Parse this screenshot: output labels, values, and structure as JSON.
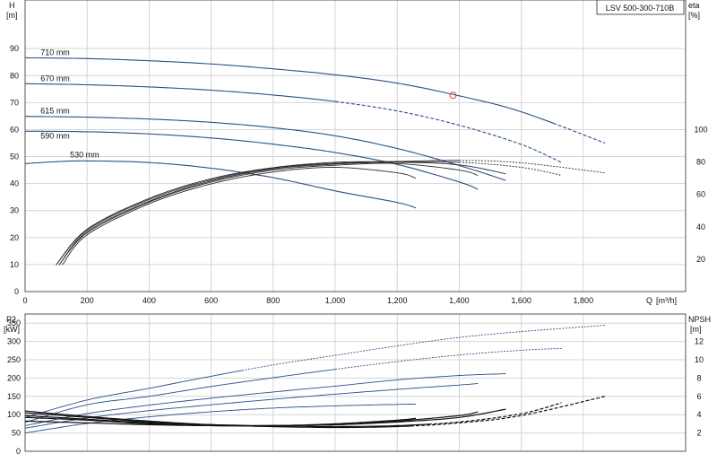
{
  "chart_data": [
    {
      "type": "line",
      "title": "LSV 500-300-710B",
      "ylabel": "H",
      "yunit": "[m]",
      "y2label": "eta",
      "y2unit": "[%]",
      "xlabel": "Q",
      "xunit": "[m³/h]",
      "xlim": [
        0,
        2130
      ],
      "ylim": [
        0,
        108
      ],
      "y2lim": [
        0,
        180
      ],
      "x_ticks": [
        0,
        200,
        400,
        600,
        800,
        1000,
        1200,
        1400,
        1600,
        1800
      ],
      "x_tick_labels": [
        "0",
        "200",
        "400",
        "600",
        "800",
        "1,000",
        "1,200",
        "1,400",
        "1,600",
        "1,800"
      ],
      "y_ticks": [
        0,
        10,
        20,
        30,
        40,
        50,
        60,
        70,
        80,
        90
      ],
      "y2_ticks": [
        20,
        40,
        60,
        80,
        100
      ],
      "grid": true,
      "series": [
        {
          "name": "710 mm",
          "x": [
            0,
            200,
            400,
            600,
            800,
            1000,
            1200,
            1400,
            1600,
            1870
          ],
          "y": [
            86.6,
            86.3,
            85.5,
            84.3,
            82.5,
            80.3,
            77.2,
            72.5,
            66.6,
            55.0
          ],
          "solid_until": 1720,
          "label_at": [
            50,
            87.5
          ]
        },
        {
          "name": "670 mm",
          "x": [
            0,
            200,
            400,
            600,
            800,
            1000,
            1200,
            1400,
            1600,
            1730
          ],
          "y": [
            77.0,
            76.6,
            75.8,
            74.6,
            72.8,
            70.4,
            66.9,
            61.6,
            54.5,
            47.8
          ],
          "solid_until": 1000,
          "label_at": [
            50,
            78.0
          ]
        },
        {
          "name": "615 mm",
          "x": [
            0,
            200,
            400,
            600,
            800,
            1000,
            1200,
            1400,
            1550
          ],
          "y": [
            64.9,
            64.6,
            63.9,
            62.7,
            60.7,
            57.7,
            53.0,
            46.7,
            41.2
          ],
          "solid_until": 1550,
          "label_at": [
            50,
            66.0
          ]
        },
        {
          "name": "590 mm",
          "x": [
            0,
            200,
            400,
            600,
            800,
            1000,
            1200,
            1400,
            1460
          ],
          "y": [
            59.4,
            59.2,
            58.4,
            56.9,
            54.6,
            51.5,
            47.1,
            40.6,
            37.9
          ],
          "solid_until": 1460,
          "label_at": [
            50,
            56.6
          ]
        },
        {
          "name": "530 mm",
          "x": [
            0,
            100,
            200,
            400,
            600,
            800,
            1000,
            1200,
            1260
          ],
          "y": [
            47.4,
            48.1,
            48.4,
            47.8,
            45.7,
            42.2,
            37.3,
            33.0,
            31.0
          ],
          "solid_until": 1260,
          "label_at": [
            145,
            49.7
          ]
        }
      ],
      "efficiency_series": [
        {
          "curve": "710 mm",
          "x": [
            100,
            200,
            400,
            600,
            800,
            1000,
            1200,
            1400,
            1600,
            1870
          ],
          "y": [
            16.5,
            38.5,
            57.5,
            69.7,
            76.5,
            79.8,
            80.3,
            81.0,
            79.5,
            73.3
          ],
          "solid_until": 1400
        },
        {
          "curve": "670 mm",
          "x": [
            100,
            200,
            400,
            600,
            800,
            1000,
            1200,
            1400,
            1600,
            1730
          ],
          "y": [
            16.5,
            38.0,
            56.8,
            69.0,
            76.2,
            79.2,
            80.0,
            79.8,
            76.7,
            71.7
          ],
          "solid_until": 1400
        },
        {
          "curve": "615 mm",
          "x": [
            110,
            200,
            400,
            600,
            800,
            1000,
            1200,
            1400,
            1550
          ],
          "y": [
            16.5,
            37.0,
            55.8,
            68.3,
            75.7,
            78.7,
            79.8,
            78.2,
            72.7
          ],
          "solid_until": 1550
        },
        {
          "curve": "590 mm",
          "x": [
            110,
            200,
            400,
            600,
            800,
            1000,
            1200,
            1400,
            1460
          ],
          "y": [
            16.5,
            36.2,
            55.2,
            67.6,
            75.0,
            78.0,
            79.0,
            75.0,
            71.7
          ],
          "solid_until": 1460
        },
        {
          "curve": "530 mm",
          "x": [
            120,
            200,
            400,
            600,
            800,
            1000,
            1200,
            1260
          ],
          "y": [
            16.5,
            35.0,
            54.2,
            66.5,
            73.8,
            76.7,
            73.3,
            70.0
          ],
          "solid_until": 1260
        }
      ],
      "marker": {
        "x": 1380,
        "y": 72.7
      }
    },
    {
      "type": "line",
      "ylabel": "P2",
      "yunit": "[kW]",
      "y2label": "NPSH",
      "y2unit": "[m]",
      "xlim": [
        0,
        2130
      ],
      "ylim": [
        0,
        375
      ],
      "y2lim": [
        0,
        15
      ],
      "y_ticks": [
        0,
        50,
        100,
        150,
        200,
        250,
        300,
        350
      ],
      "y2_ticks": [
        2,
        4,
        6,
        8,
        10,
        12
      ],
      "grid": true,
      "power_series": [
        {
          "curve": "710 mm",
          "x": [
            0,
            200,
            400,
            600,
            800,
            1000,
            1200,
            1400,
            1600,
            1870
          ],
          "y": [
            92,
            140,
            172,
            205,
            236,
            262,
            288,
            311,
            327,
            344
          ],
          "solid_until": 700
        },
        {
          "curve": "670 mm",
          "x": [
            0,
            200,
            400,
            600,
            800,
            1000,
            1200,
            1400,
            1600,
            1730
          ],
          "y": [
            79,
            127,
            150,
            177,
            201,
            224,
            245,
            263,
            276,
            281
          ],
          "solid_until": 1000
        },
        {
          "curve": "615 mm",
          "x": [
            0,
            200,
            400,
            600,
            800,
            1000,
            1200,
            1400,
            1550
          ],
          "y": [
            70,
            103,
            126,
            145,
            162,
            178,
            195,
            207,
            212
          ],
          "solid_until": 1550
        },
        {
          "curve": "590 mm",
          "x": [
            0,
            200,
            400,
            600,
            800,
            1000,
            1200,
            1400,
            1460
          ],
          "y": [
            63,
            91,
            111,
            127,
            142,
            156,
            169,
            181,
            185
          ],
          "solid_until": 1460
        },
        {
          "curve": "530 mm",
          "x": [
            0,
            200,
            400,
            600,
            800,
            1000,
            1200,
            1260
          ],
          "y": [
            50,
            76,
            94,
            108,
            118,
            124,
            128,
            129
          ],
          "solid_until": 1260
        }
      ],
      "npsh_series": [
        {
          "curve": "710 mm",
          "x": [
            0,
            200,
            400,
            600,
            800,
            1000,
            1200,
            1400,
            1600,
            1870
          ],
          "y": [
            4.4,
            3.8,
            3.3,
            2.9,
            2.7,
            2.6,
            2.7,
            3.1,
            3.9,
            6.0
          ],
          "solid_until": 1250
        },
        {
          "curve": "670 mm",
          "x": [
            0,
            200,
            400,
            600,
            800,
            1000,
            1200,
            1400,
            1600,
            1730
          ],
          "y": [
            4.2,
            3.7,
            3.2,
            2.9,
            2.7,
            2.7,
            2.8,
            3.2,
            4.1,
            5.3
          ],
          "solid_until": 1300
        },
        {
          "curve": "615 mm",
          "x": [
            0,
            200,
            400,
            600,
            800,
            1000,
            1200,
            1400,
            1550
          ],
          "y": [
            3.9,
            3.5,
            3.1,
            2.9,
            2.8,
            2.9,
            3.2,
            3.7,
            4.6
          ],
          "solid_until": 1550
        },
        {
          "curve": "590 mm",
          "x": [
            0,
            200,
            400,
            600,
            800,
            1000,
            1200,
            1400,
            1460
          ],
          "y": [
            3.7,
            3.4,
            3.0,
            2.8,
            2.8,
            2.9,
            3.3,
            3.9,
            4.3
          ],
          "solid_until": 1460
        },
        {
          "curve": "530 mm",
          "x": [
            0,
            200,
            400,
            600,
            800,
            1000,
            1200,
            1260
          ],
          "y": [
            3.3,
            3.1,
            2.9,
            2.8,
            2.8,
            3.0,
            3.4,
            3.6
          ],
          "solid_until": 1260
        }
      ]
    }
  ],
  "colors": {
    "curve": "#27508a",
    "efficiency": "#2b2b2b",
    "grid": "#d4d4d4",
    "axis": "#444444",
    "marker": "#e04040"
  }
}
